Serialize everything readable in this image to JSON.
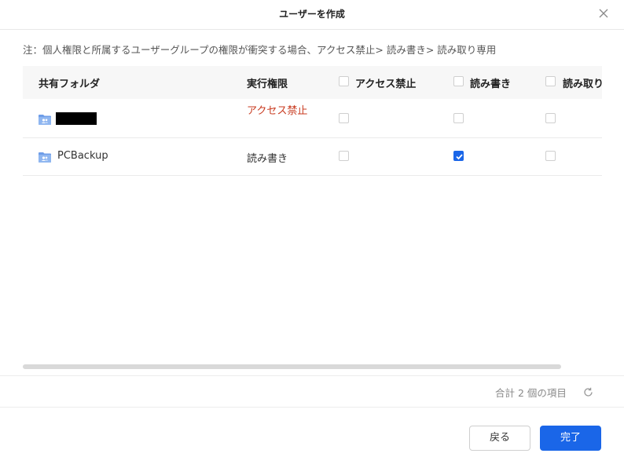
{
  "dialog": {
    "title": "ユーザーを作成",
    "note": "注：個人権限と所属するユーザーグループの権限が衝突する場合、アクセス禁止> 読み書き> 読み取り専用"
  },
  "table": {
    "headers": {
      "folder": "共有フォルダ",
      "effective": "実行権限",
      "deny": "アクセス禁止",
      "readwrite": "読み書き",
      "readonly": "読み取り"
    },
    "rows": [
      {
        "name": "",
        "effective": "アクセス禁止",
        "deny": false,
        "readwrite": false,
        "readonly": false
      },
      {
        "name": "PCBackup",
        "effective": "読み書き",
        "deny": false,
        "readwrite": true,
        "readonly": false
      }
    ]
  },
  "footer": {
    "count": "合計 2 個の項目",
    "back_label": "戻る",
    "done_label": "完了"
  },
  "colors": {
    "accent": "#1a66e8",
    "deny_text": "#c83a1f"
  }
}
